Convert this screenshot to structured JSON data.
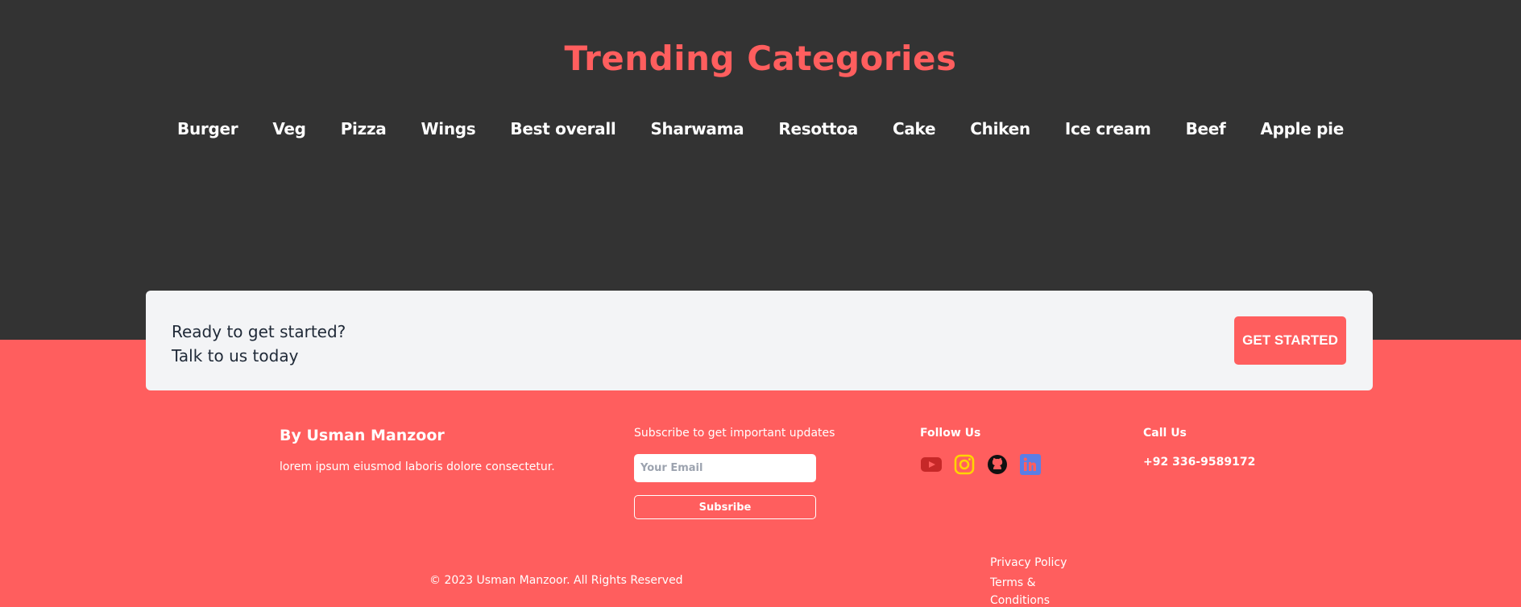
{
  "section": {
    "title": "Trending Categories"
  },
  "categories": [
    "Burger",
    "Veg",
    "Pizza",
    "Wings",
    "Best overall",
    "Sharwama",
    "Resottoa",
    "Cake",
    "Chiken",
    "Ice cream",
    "Beef",
    "Apple pie"
  ],
  "cta": {
    "line1": "Ready to get started?",
    "line2": "Talk to us today",
    "button": "GET STARTED"
  },
  "footer": {
    "author": "By Usman Manzoor",
    "description": "lorem ipsum eiusmod laboris dolore consectetur.",
    "subscribe_label": "Subscribe to get important updates",
    "email_placeholder": "Your Email",
    "subscribe_button": "Subsribe",
    "follow_label": "Follow Us",
    "social_icons": [
      "youtube-icon",
      "instagram-icon",
      "github-icon",
      "linkedin-icon"
    ],
    "call_label": "Call Us",
    "phone": "+92 336-9589172",
    "copyright": "© 2023 Usman Manzoor. All Rights Reserved",
    "privacy": "Privacy Policy",
    "terms": "Terms & Conditions"
  },
  "colors": {
    "accent": "#ff5e5e",
    "dark_bg": "#333333",
    "card_bg": "#f3f4f6"
  }
}
